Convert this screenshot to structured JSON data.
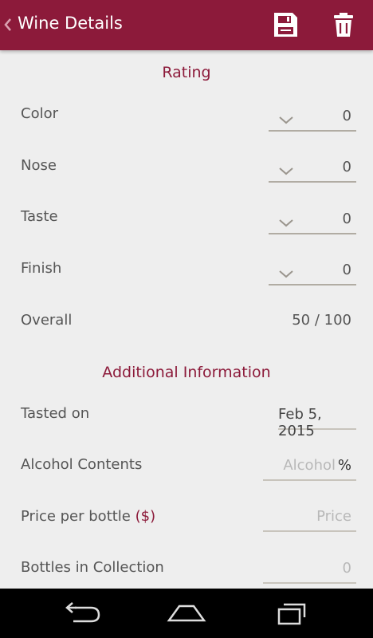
{
  "appbar": {
    "title": "Wine Details",
    "bg_color": "#8c1a3a",
    "icons": [
      "back-chevron-icon",
      "save-icon",
      "trash-icon"
    ]
  },
  "rating": {
    "heading": "Rating",
    "rows": [
      {
        "label": "Color",
        "value": "0"
      },
      {
        "label": "Nose",
        "value": "0"
      },
      {
        "label": "Taste",
        "value": "0"
      },
      {
        "label": "Finish",
        "value": "0"
      }
    ],
    "overall_label": "Overall",
    "overall_value": "50 / 100"
  },
  "additional": {
    "heading": "Additional Information",
    "tasted_on_label": "Tasted on",
    "tasted_on_value": "Feb 5, 2015",
    "alcohol_label": "Alcohol Contents",
    "alcohol_placeholder": "Alcohol",
    "alcohol_unit": "%",
    "price_label": "Price per bottle",
    "price_currency": "($)",
    "price_placeholder": "Price",
    "bottles_label": "Bottles in Collection",
    "bottles_placeholder": "0"
  },
  "navbar": {
    "icons": [
      "back-icon",
      "home-icon",
      "recents-icon"
    ]
  }
}
